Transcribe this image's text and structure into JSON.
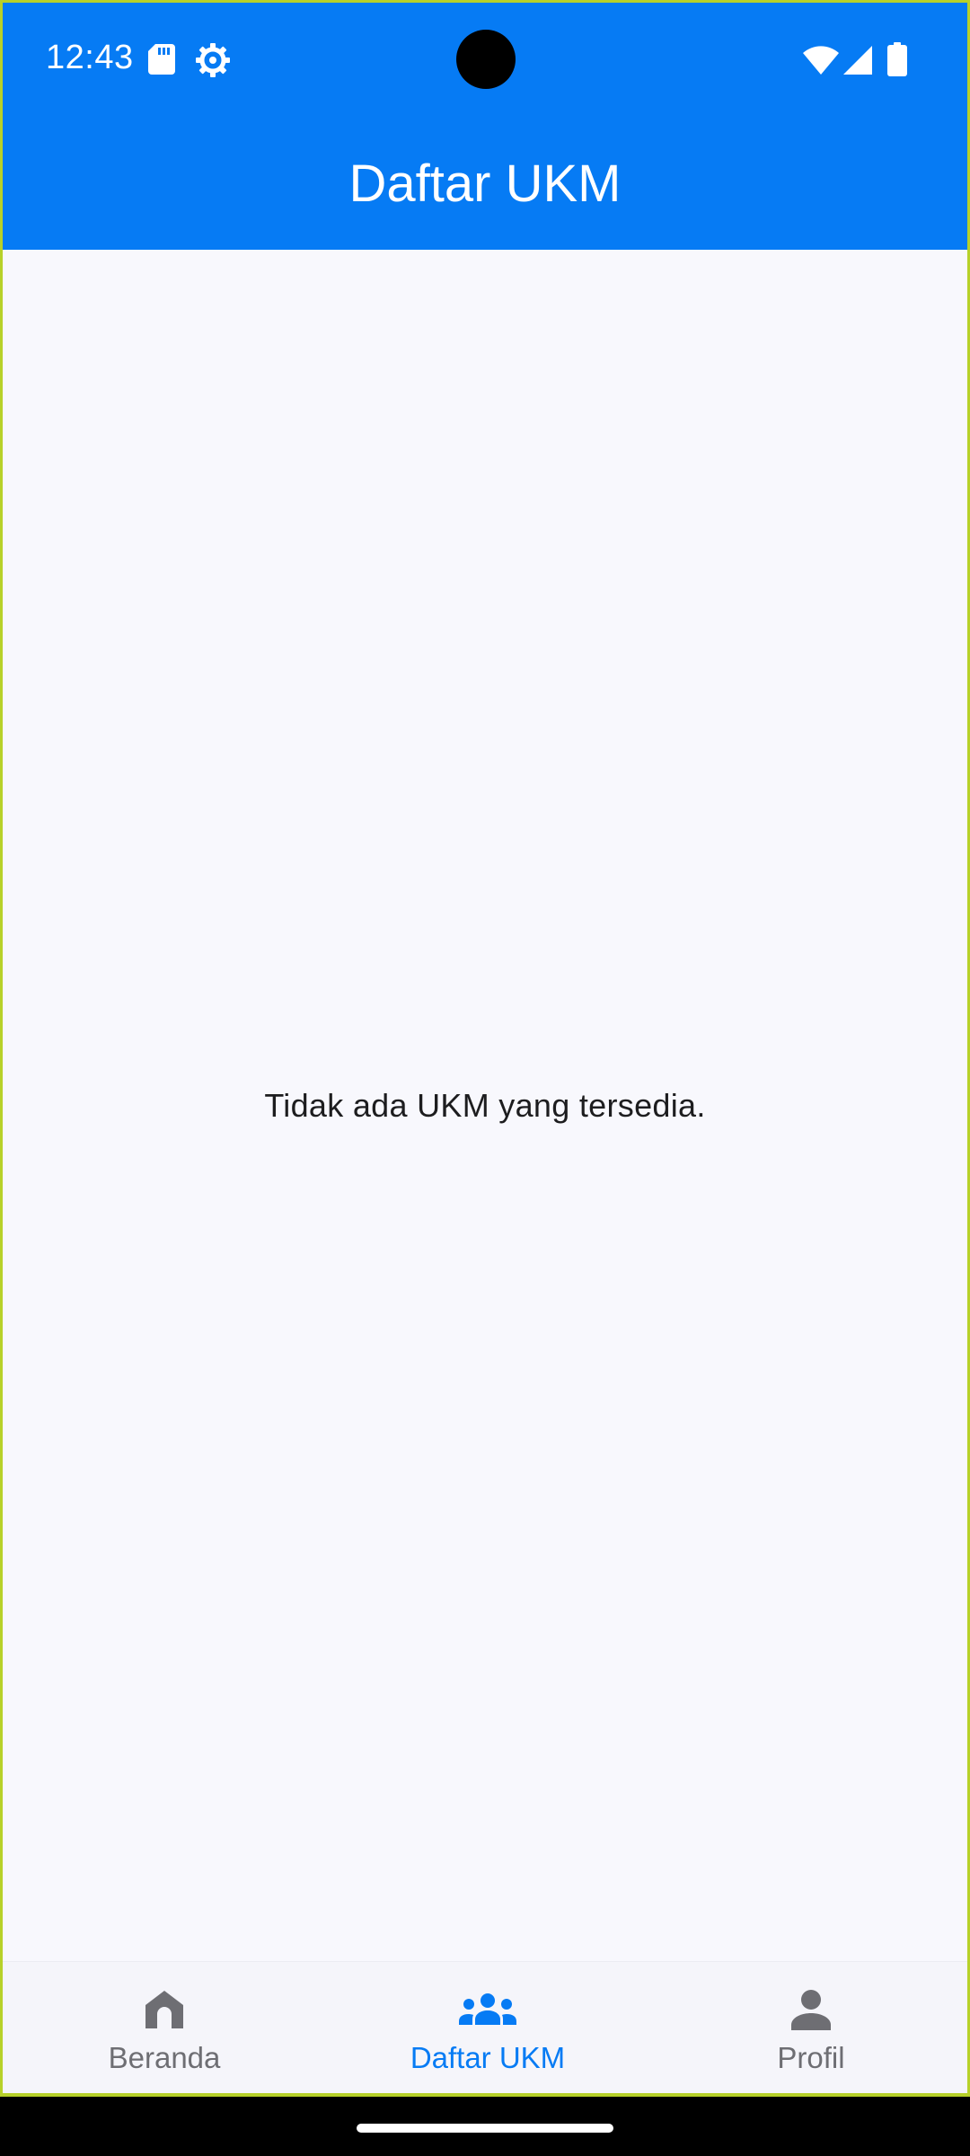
{
  "status_bar": {
    "time": "12:43",
    "icons": [
      "sd-card-icon",
      "settings-gear-icon",
      "wifi-icon",
      "signal-icon",
      "battery-icon"
    ]
  },
  "app_bar": {
    "title": "Daftar UKM"
  },
  "main": {
    "empty_message": "Tidak ada UKM yang tersedia."
  },
  "bottom_nav": {
    "items": [
      {
        "label": "Beranda",
        "icon": "home-icon",
        "active": false
      },
      {
        "label": "Daftar UKM",
        "icon": "groups-icon",
        "active": true
      },
      {
        "label": "Profil",
        "icon": "person-icon",
        "active": false
      }
    ]
  },
  "colors": {
    "primary": "#067bf4",
    "background": "#f8f8fd",
    "inactive": "#6e6e73"
  }
}
